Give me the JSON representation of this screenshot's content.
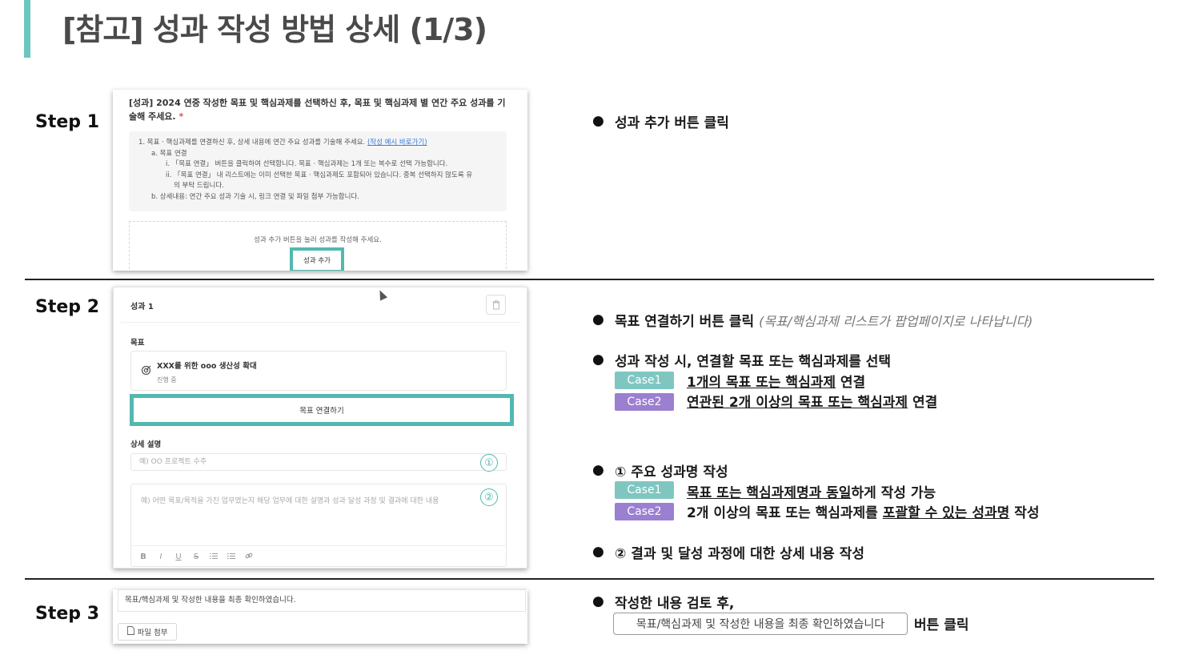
{
  "title": "[참고] 성과 작성 방법 상세 (1/3)",
  "colors": {
    "accent": "#6cc5c0",
    "highlight": "#52b8b0",
    "case1": "#7fc6c1",
    "case2": "#9b7fd1"
  },
  "steps": [
    {
      "label": "Step 1"
    },
    {
      "label": "Step 2"
    },
    {
      "label": "Step 3"
    }
  ],
  "step1_screen": {
    "question": "[성과] 2024 연중 작성한 목표 및 핵심과제를 선택하신 후, 목표 및 핵심과제 별 연간 주요 성과를 기술해 주세요.",
    "required_mark": "*",
    "guide_lines": [
      "1. 목표 · 핵심과제를 연결하신 후, 상세 내용에 연간 주요 성과를 기술해 주세요.",
      "a. 목표 연결",
      "i. 「목표 연결」 버튼을 클릭하여 선택합니다. 목표 · 핵심과제는 1개 또는 복수로 선택 가능합니다.",
      "ii. 「목표 연결」 내 리스트에는 이미 선택한 목표 · 핵심과제도 포함되어 있습니다. 중복 선택하지 않도록 유",
      "의 부탁 드립니다.",
      "b. 상세내용: 연간 주요 성과 기술 시, 링크 연결 및 파일 첨부 가능합니다."
    ],
    "guide_link": "(작성 예시 바로가기)",
    "drop_hint": "성과 추가 버튼을 눌러 성과를 작성해 주세요.",
    "add_button": "성과 추가"
  },
  "step2_screen": {
    "card_title": "성과 1",
    "trash_icon": "trash-icon",
    "goal_label": "목표",
    "goal_title": "XXX를 위한 ooo 생산성 확대",
    "goal_status": "진행 중",
    "link_button": "목표 연결하기",
    "detail_label": "상세 설명",
    "title_placeholder": "예) OO 프로젝트 수주",
    "body_placeholder": "예) 어떤 목표/목적을 가진 업무였는지 해당 업무에 대한 설명과 성과 달성 과정 및 결과에 대한 내용",
    "toolbar": [
      "B",
      "I",
      "U",
      "S",
      "ordered-list-icon",
      "bullet-list-icon",
      "link-icon"
    ],
    "marker1": "①",
    "marker2": "②"
  },
  "step3_screen": {
    "confirm_text": "목표/핵심과제 및 작성한 내용을 최종 확인하였습니다.",
    "attach_button": "파일 첨부"
  },
  "instructions": {
    "step1": {
      "text": "성과 추가 버튼 클릭"
    },
    "step2_a": {
      "text": "목표 연결하기 버튼 클릭",
      "note": "(목표/핵심과제 리스트가 팝업페이지로 나타납니다)"
    },
    "step2_b": {
      "text": "성과 작성 시, 연결할 목표 또는 핵심과제를 선택",
      "cases": [
        {
          "badge": "Case1",
          "underlined": "1개의 목표 또는 핵심과제",
          "rest": " 연결"
        },
        {
          "badge": "Case2",
          "underlined": "연관된 2개 이상의 목표 또는 핵심과제",
          "rest": " 연결"
        }
      ]
    },
    "step2_c": {
      "text": "① 주요 성과명 작성",
      "cases": [
        {
          "badge": "Case1",
          "underlined": "목표 또는 핵심과제명과 동일",
          "rest": "하게 작성 가능"
        },
        {
          "badge": "Case2",
          "plain": "2개 이상의 목표 또는 핵심과제를 ",
          "underlined": "포괄할 수 있는 성과명",
          "rest": " 작성"
        }
      ]
    },
    "step2_d": {
      "text": "② 결과 및 달성 과정에 대한 상세 내용 작성"
    },
    "step3": {
      "text": "작성한 내용 검토 후,",
      "button": "목표/핵심과제 및 작성한 내용을 최종 확인하였습니다",
      "after": "버튼 클릭"
    }
  }
}
